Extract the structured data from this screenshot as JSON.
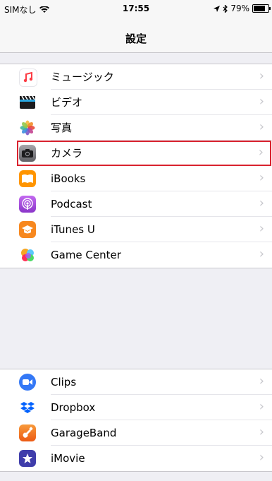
{
  "status": {
    "carrier": "SIMなし",
    "wifi": "wifi-icon",
    "time": "17:55",
    "location": "location-icon",
    "bluetooth": "bluetooth-icon",
    "battery": "79%",
    "battery_level": 0.79
  },
  "nav": {
    "title": "設定"
  },
  "group1": [
    {
      "label": "ミュージック",
      "icon": "music-icon",
      "color": "#fc3c44",
      "highlight": false
    },
    {
      "label": "ビデオ",
      "icon": "clapperboard-icon",
      "color": "#2b2b2b",
      "highlight": false
    },
    {
      "label": "写真",
      "icon": "photos-flower-icon",
      "color": "#ffffff",
      "highlight": false
    },
    {
      "label": "カメラ",
      "icon": "camera-icon",
      "color": "#8e8e93",
      "highlight": true
    },
    {
      "label": "iBooks",
      "icon": "book-icon",
      "color": "#ff9500",
      "highlight": false
    },
    {
      "label": "Podcast",
      "icon": "podcast-icon",
      "color": "#b150e2",
      "highlight": false
    },
    {
      "label": "iTunes U",
      "icon": "graduation-cap-icon",
      "color": "#f7881f",
      "highlight": false
    },
    {
      "label": "Game Center",
      "icon": "game-center-icon",
      "color": "#ffffff",
      "highlight": false
    }
  ],
  "group2": [
    {
      "label": "Clips",
      "icon": "clips-icon",
      "color": "#3478f6"
    },
    {
      "label": "Dropbox",
      "icon": "dropbox-icon",
      "color": "#ffffff"
    },
    {
      "label": "GarageBand",
      "icon": "guitar-icon",
      "color": "#f76b1c"
    },
    {
      "label": "iMovie",
      "icon": "star-icon",
      "color": "#3f3dab"
    }
  ]
}
